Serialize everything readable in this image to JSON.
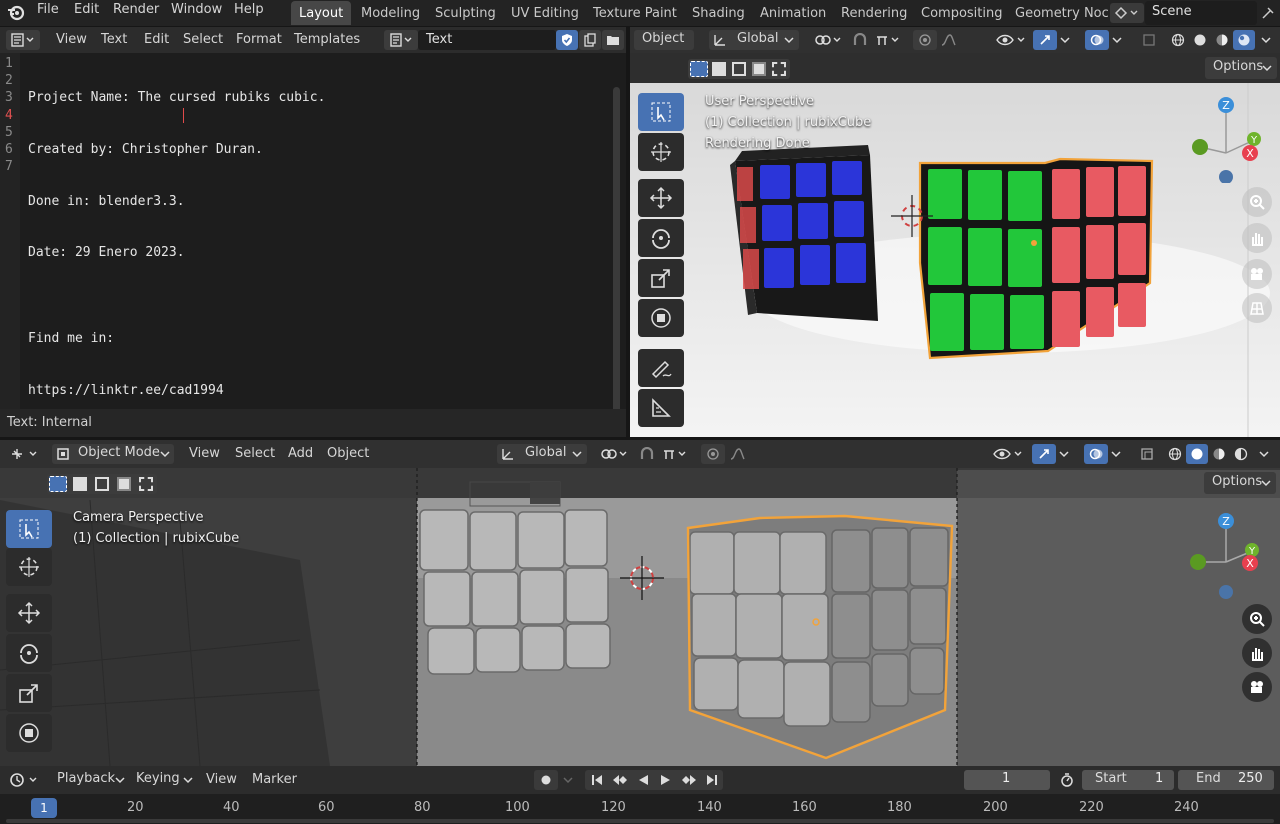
{
  "topbar": {
    "menus": [
      "File",
      "Edit",
      "Render",
      "Window",
      "Help"
    ],
    "workspaces": [
      "Layout",
      "Modeling",
      "Sculpting",
      "UV Editing",
      "Texture Paint",
      "Shading",
      "Animation",
      "Rendering",
      "Compositing",
      "Geometry Noc"
    ],
    "active_workspace": "Layout",
    "scene": "Scene"
  },
  "text_editor": {
    "menus": [
      "View",
      "Text",
      "Edit",
      "Select",
      "Format",
      "Templates"
    ],
    "datablock": "Text",
    "line_numbers": [
      "1",
      "2",
      "3",
      "4",
      "5",
      "6",
      "7"
    ],
    "lines": [
      "Project Name: The cursed rubiks cubic.",
      "Created by: Christopher Duran.",
      "Done in: blender3.3.",
      "Date: 29 Enero 2023.",
      "",
      "Find me in:",
      "https://linktr.ee/cad1994"
    ],
    "status": "Text: Internal"
  },
  "viewport_top": {
    "mode": "Object",
    "orientation": "Global",
    "options": "Options",
    "overlay_lines": [
      "User Perspective",
      "(1) Collection | rubixCube",
      "Rendering Done"
    ],
    "gizmo_axes": [
      "Z",
      "Y",
      "X"
    ]
  },
  "viewport_bottom": {
    "mode": "Object Mode",
    "menus": [
      "View",
      "Select",
      "Add",
      "Object"
    ],
    "orientation": "Global",
    "options": "Options",
    "overlay_lines": [
      "Camera Perspective",
      "(1) Collection | rubixCube"
    ],
    "gizmo_axes": [
      "Z",
      "Y",
      "X"
    ]
  },
  "timeline": {
    "menus": [
      "Playback",
      "Keying",
      "View",
      "Marker"
    ],
    "current_frame": "1",
    "start_label": "Start",
    "start": "1",
    "end_label": "End",
    "end": "250",
    "ruler": [
      "1",
      "20",
      "40",
      "60",
      "80",
      "100",
      "120",
      "140",
      "160",
      "180",
      "200",
      "220",
      "240"
    ]
  },
  "colors": {
    "accent": "#4772b3",
    "selection": "#f2a33a",
    "axis_x": "#e8404f",
    "axis_y": "#6fb42c",
    "axis_z": "#3b8fd9"
  }
}
